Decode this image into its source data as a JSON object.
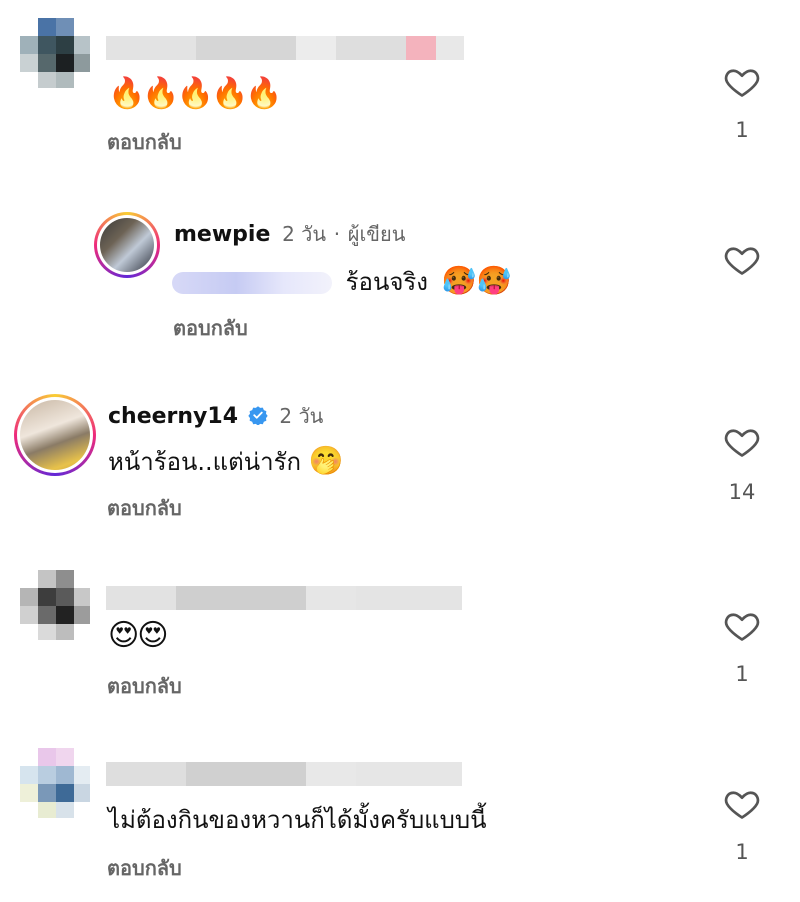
{
  "comments": [
    {
      "text": "🔥🔥🔥🔥🔥",
      "reply_label": "ตอบกลับ",
      "likes": "1"
    },
    {
      "username": "mewpie",
      "time": "2 วัน",
      "separator": "·",
      "role": "ผู้เขียน",
      "text": "ร้อนจริง",
      "emojis": "🥵🥵",
      "reply_label": "ตอบกลับ"
    },
    {
      "username": "cheerny14",
      "time": "2 วัน",
      "text": "หน้าร้อน..แต่น่ารัก",
      "emojis": "🤭",
      "reply_label": "ตอบกลับ",
      "likes": "14"
    },
    {
      "text": "😍😍",
      "reply_label": "ตอบกลับ",
      "likes": "1"
    },
    {
      "text": "ไม่ต้องกินของหวานก็ได้มั้งครับแบบนี้",
      "reply_label": "ตอบกลับ",
      "likes": "1"
    }
  ],
  "icons": {
    "like": "heart-outline-icon",
    "verified": "verified-badge-icon"
  },
  "colors": {
    "ring_start": "#f9ce34",
    "ring_mid": "#ee2a7b",
    "verified_blue": "#3897f0",
    "meta_gray": "#666666"
  }
}
